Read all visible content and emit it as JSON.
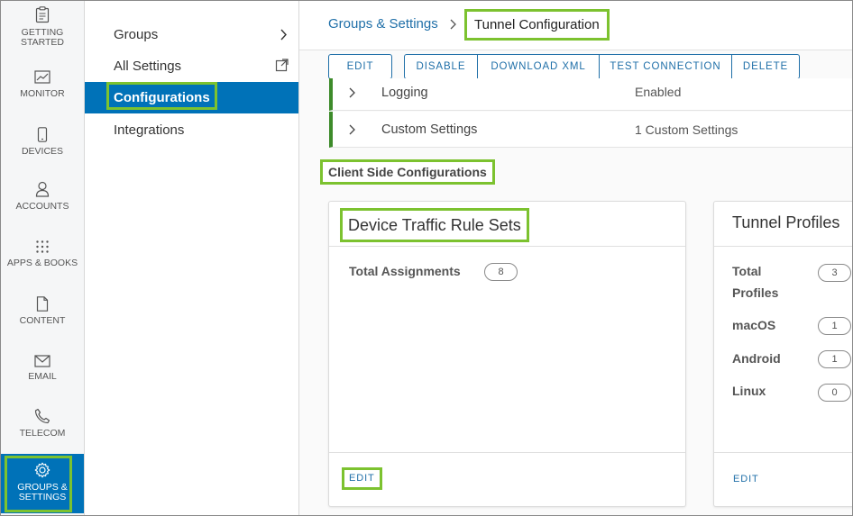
{
  "rail": {
    "items": [
      {
        "label": "GETTING STARTED",
        "icon": "clipboard-icon"
      },
      {
        "label": "MONITOR",
        "icon": "chart-icon"
      },
      {
        "label": "DEVICES",
        "icon": "phone-icon"
      },
      {
        "label": "ACCOUNTS",
        "icon": "user-icon"
      },
      {
        "label": "APPS & BOOKS",
        "icon": "grid-icon"
      },
      {
        "label": "CONTENT",
        "icon": "document-icon"
      },
      {
        "label": "EMAIL",
        "icon": "envelope-icon"
      },
      {
        "label": "TELECOM",
        "icon": "handset-icon"
      },
      {
        "label": "GROUPS & SETTINGS",
        "icon": "gear-icon"
      }
    ]
  },
  "subnav": {
    "groups": "Groups",
    "all_settings": "All Settings",
    "configurations": "Configurations",
    "integrations": "Integrations"
  },
  "breadcrumb": {
    "parent": "Groups & Settings",
    "current": "Tunnel Configuration"
  },
  "toolbar": {
    "edit": "EDIT",
    "disable": "DISABLE",
    "download_xml": "DOWNLOAD XML",
    "test_connection": "TEST CONNECTION",
    "delete": "DELETE"
  },
  "settings_rows": [
    {
      "name": "Logging",
      "value": "Enabled"
    },
    {
      "name": "Custom Settings",
      "value": "1 Custom Settings"
    }
  ],
  "section_title": "Client Side Configurations",
  "cards": {
    "traffic": {
      "title": "Device Traffic Rule Sets",
      "stat_label": "Total Assignments",
      "stat_value": "8",
      "edit": "EDIT"
    },
    "profiles": {
      "title": "Tunnel Profiles",
      "stats": [
        {
          "label": "Total Profiles",
          "value": "3"
        },
        {
          "label": "macOS",
          "value": "1"
        },
        {
          "label": "Android",
          "value": "1"
        },
        {
          "label": "Linux",
          "value": "0"
        }
      ],
      "edit": "EDIT"
    }
  },
  "colors": {
    "accent": "#0072b8",
    "highlight": "#7cc22f",
    "row_marker": "#3d8b2a",
    "link": "#1f6fa8"
  }
}
